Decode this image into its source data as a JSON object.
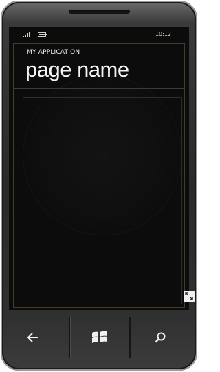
{
  "status_bar": {
    "time": "10:12",
    "icons": [
      "signal-icon",
      "battery-icon"
    ]
  },
  "header": {
    "app_title": "MY APPLICATION",
    "page_title": "page name"
  },
  "nav_bar": {
    "buttons": [
      "back-icon",
      "windows-start-icon",
      "search-icon"
    ]
  },
  "colors": {
    "screen_background": "#0c0c0c",
    "text": "#f4f4f4",
    "guide_lines": "#4a3a2a",
    "bezel": "#2a2a2a"
  }
}
